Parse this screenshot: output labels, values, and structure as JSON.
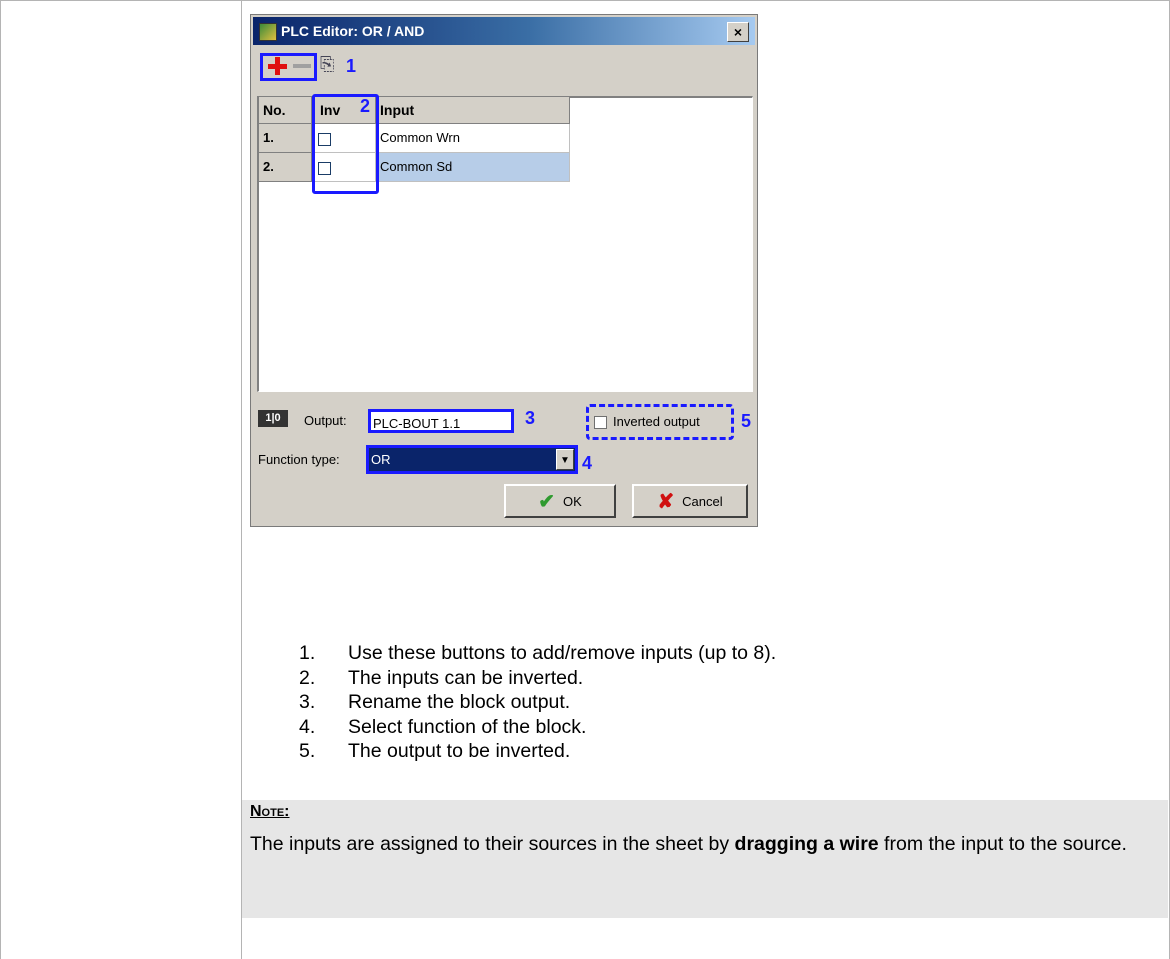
{
  "dialog": {
    "title": "PLC Editor: OR / AND",
    "close": "×",
    "annotations": [
      "1",
      "2",
      "3",
      "4",
      "5"
    ],
    "table": {
      "headers": {
        "no": "No.",
        "inv": "Inv",
        "input": "Input"
      },
      "rows": [
        {
          "no": "1.",
          "input": "Common Wrn"
        },
        {
          "no": "2.",
          "input": "Common Sd"
        }
      ]
    },
    "output_label": "Output:",
    "output_value": "PLC-BOUT 1.1",
    "output_icon_text": "1|0",
    "inverted_output_label": "Inverted output",
    "function_type_label": "Function type:",
    "function_type_value": "OR",
    "ok_label": "OK",
    "cancel_label": "Cancel"
  },
  "steps": [
    {
      "num": "1.",
      "text": "Use these buttons to add/remove inputs (up to 8)."
    },
    {
      "num": "2.",
      "text": "The inputs can be inverted."
    },
    {
      "num": "3.",
      "text": "Rename the block output."
    },
    {
      "num": "4.",
      "text": "Select function of the block."
    },
    {
      "num": "5.",
      "text": "The output to be inverted."
    }
  ],
  "note": {
    "heading": "Note:",
    "text_before": "The inputs are assigned to their sources in the sheet by ",
    "text_bold": "dragging a wire",
    "text_after": " from the input to the source."
  },
  "icons": {
    "add": "plus-icon",
    "remove": "minus-icon",
    "tool": "tool-icon",
    "ok": "check-icon",
    "cancel": "x-icon"
  },
  "colors": {
    "highlight": "#1a1aff",
    "titlebar": "#0a246a",
    "selected_row": "#b7cde8",
    "note_bg": "#e6e6e6"
  }
}
